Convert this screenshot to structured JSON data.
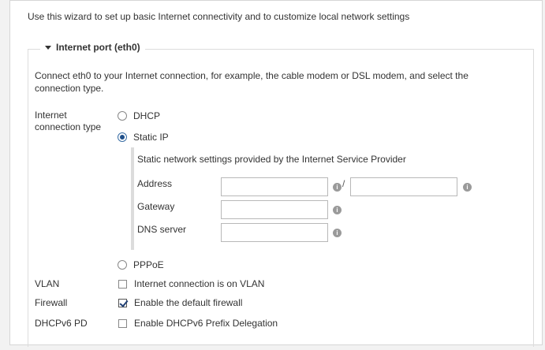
{
  "intro": "Use this wizard to set up basic Internet connectivity and to customize local network settings",
  "section": {
    "title": "Internet port (eth0)",
    "description": "Connect eth0 to your Internet connection, for example, the cable modem or DSL modem, and select the connection type."
  },
  "connection_type": {
    "label_line1": "Internet",
    "label_line2": "connection type",
    "options": [
      {
        "label": "DHCP",
        "selected": false
      },
      {
        "label": "Static IP",
        "selected": true
      },
      {
        "label": "PPPoE",
        "selected": false
      }
    ]
  },
  "static": {
    "heading": "Static network settings provided by the Internet Service Provider",
    "address_label": "Address",
    "address_value": "",
    "address_separator": "/",
    "prefix_value": "",
    "gateway_label": "Gateway",
    "gateway_value": "",
    "dns_label": "DNS server",
    "dns_value": ""
  },
  "vlan": {
    "label": "VLAN",
    "checkbox_label": "Internet connection is on VLAN",
    "checked": false
  },
  "firewall": {
    "label": "Firewall",
    "checkbox_label": "Enable the default firewall",
    "checked": true
  },
  "dhcpv6": {
    "label": "DHCPv6 PD",
    "checkbox_label": "Enable DHCPv6 Prefix Delegation",
    "checked": false
  },
  "icons": {
    "info": "info-icon",
    "collapse": "caret-down-icon"
  }
}
